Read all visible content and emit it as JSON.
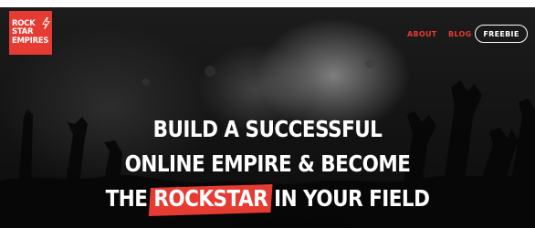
{
  "brand": {
    "logo_line1": "ROCK",
    "logo_line2": "STAR",
    "logo_line3": "EMPIRES",
    "accent_color": "#e63b32",
    "logo_icon": "lightning-bolt-icon"
  },
  "nav": {
    "about": "ABOUT",
    "blog": "BLOG",
    "freebie": "FREEBIE"
  },
  "hero": {
    "line1": "BUILD A SUCCESSFUL",
    "line2": "ONLINE EMPIRE & BECOME",
    "line3_pre": "THE",
    "line3_highlight": "ROCKSTAR",
    "line3_post": "IN YOUR FIELD",
    "background": "concert-crowd-photo"
  }
}
